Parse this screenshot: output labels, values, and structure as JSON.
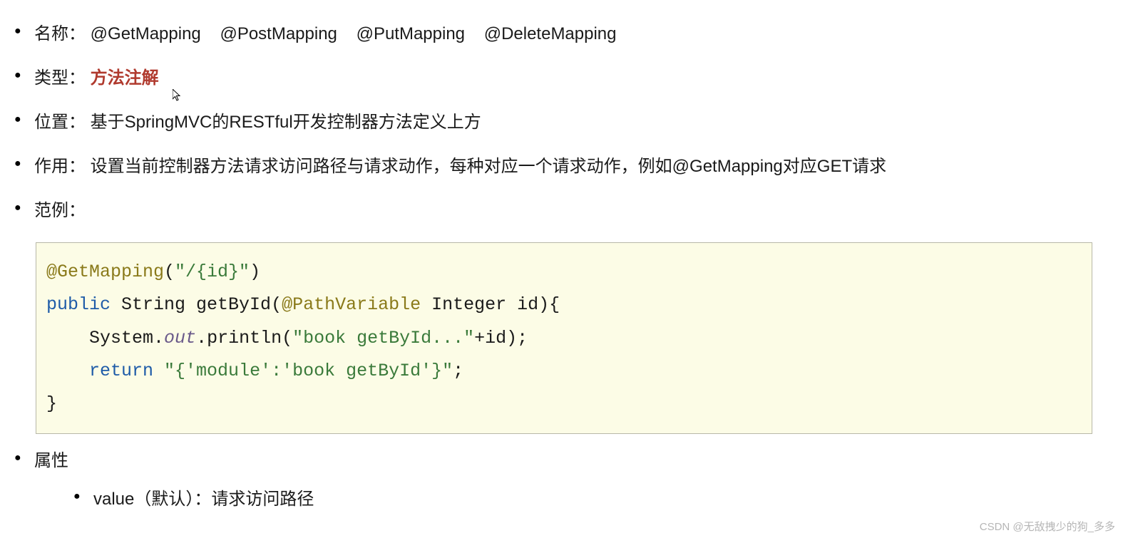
{
  "items": {
    "name": {
      "label": "名称：",
      "annotations": [
        "@GetMapping",
        "@PostMapping",
        "@PutMapping",
        "@DeleteMapping"
      ]
    },
    "type": {
      "label": "类型：",
      "value": "方法注解"
    },
    "position": {
      "label": "位置：",
      "value": "基于SpringMVC的RESTful开发控制器方法定义上方"
    },
    "purpose": {
      "label": "作用：",
      "value": "设置当前控制器方法请求访问路径与请求动作，每种对应一个请求动作，例如@GetMapping对应GET请求"
    },
    "example": {
      "label": "范例："
    },
    "attributes": {
      "label": "属性",
      "sub": {
        "value_label": "value（默认）：请求访问路径"
      }
    }
  },
  "code": {
    "l1_annotation": "@GetMapping",
    "l1_paren_open": "(",
    "l1_string": "\"/{id}\"",
    "l1_paren_close": ")",
    "l2_public": "public",
    "l2_string_type": " String ",
    "l2_method": "getById",
    "l2_paren_open": "(",
    "l2_pathvar": "@PathVariable",
    "l2_sig_rest": " Integer id){",
    "l3_indent": "    ",
    "l3_system": "System.",
    "l3_out": "out",
    "l3_println": ".println(",
    "l3_string": "\"book getById...\"",
    "l3_concat": "+id);",
    "l4_indent": "    ",
    "l4_return": "return",
    "l4_space": " ",
    "l4_string": "\"{'module':'book getById'}\"",
    "l4_semicolon": ";",
    "l5_brace": "}"
  },
  "watermark": "CSDN @无敌拽少的狗_多多"
}
